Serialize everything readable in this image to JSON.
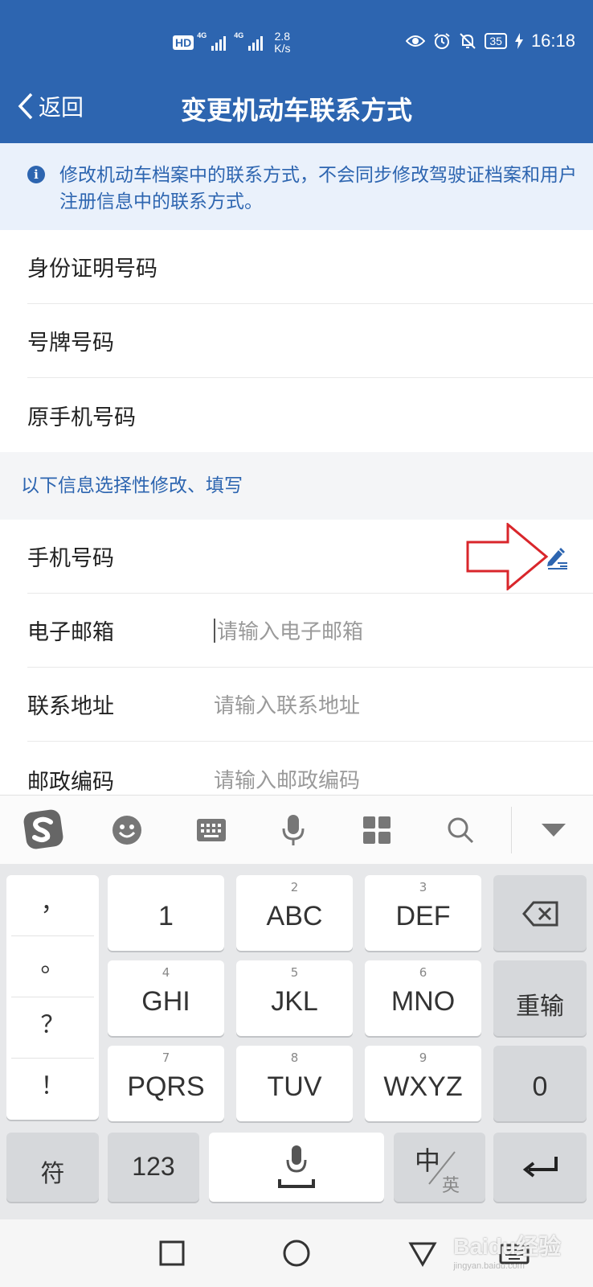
{
  "status_bar": {
    "hd": "HD",
    "net1": "4G",
    "net2": "4G",
    "speed_value": "2.8",
    "speed_unit": "K/s",
    "battery": "35",
    "time": "16:18"
  },
  "titlebar": {
    "back_label": "返回",
    "title": "变更机动车联系方式"
  },
  "notice": {
    "text": "修改机动车档案中的联系方式，不会同步修改驾驶证档案和用户注册信息中的联系方式。"
  },
  "fixed_fields": [
    {
      "label": "身份证明号码"
    },
    {
      "label": "号牌号码"
    },
    {
      "label": "原手机号码"
    }
  ],
  "optional_section": {
    "heading": "以下信息选择性修改、填写",
    "fields": [
      {
        "label": "手机号码",
        "placeholder": ""
      },
      {
        "label": "电子邮箱",
        "placeholder": "请输入电子邮箱"
      },
      {
        "label": "联系地址",
        "placeholder": "请输入联系地址"
      },
      {
        "label": "邮政编码",
        "placeholder": "请输入邮政编码"
      }
    ]
  },
  "keyboard": {
    "toolbar_icons": [
      "sogou-logo-icon",
      "emoji-icon",
      "keyboard-icon",
      "microphone-icon",
      "apps-grid-icon",
      "search-icon",
      "collapse-icon"
    ],
    "punctuation": [
      "，",
      "。",
      "？",
      "！"
    ],
    "keys": [
      {
        "num": "",
        "main": "1"
      },
      {
        "num": "2",
        "main": "ABC"
      },
      {
        "num": "3",
        "main": "DEF"
      },
      {
        "num": "4",
        "main": "GHI"
      },
      {
        "num": "5",
        "main": "JKL"
      },
      {
        "num": "6",
        "main": "MNO"
      },
      {
        "num": "7",
        "main": "PQRS"
      },
      {
        "num": "8",
        "main": "TUV"
      },
      {
        "num": "9",
        "main": "WXYZ"
      }
    ],
    "reenter": "重输",
    "zero": "0",
    "symbol": "符",
    "numeric": "123",
    "lang_main": "中",
    "lang_alt": "英"
  },
  "watermark": {
    "brand": "Baidu经验",
    "url": "jingyan.baidu.com"
  },
  "colors": {
    "brand_blue": "#2d65b0",
    "annotation_red": "#d9262b"
  }
}
